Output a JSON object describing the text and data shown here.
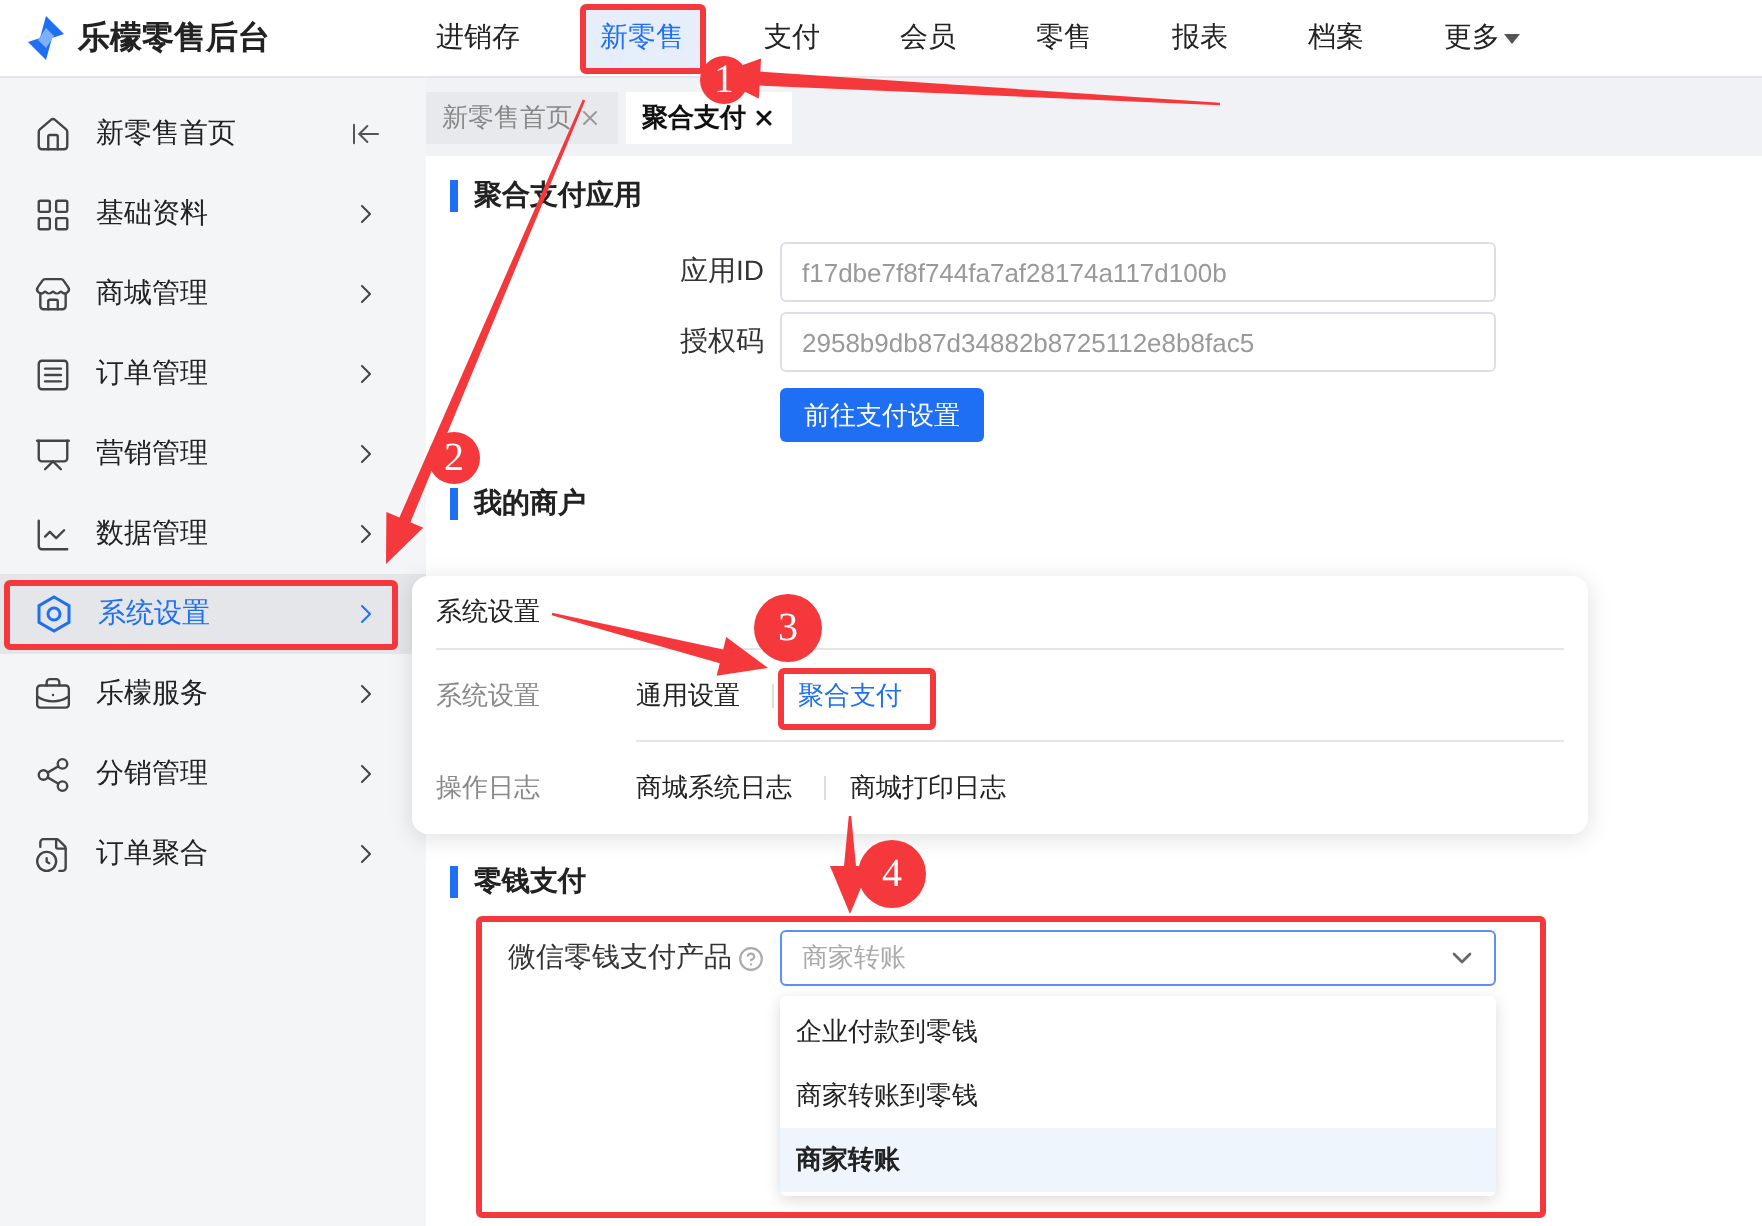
{
  "app": {
    "title": "乐檬零售后台"
  },
  "top_nav": [
    {
      "label": "进销存",
      "selected": false,
      "dropdown": false
    },
    {
      "label": "新零售",
      "selected": true,
      "dropdown": false
    },
    {
      "label": "支付",
      "selected": false,
      "dropdown": false
    },
    {
      "label": "会员",
      "selected": false,
      "dropdown": false
    },
    {
      "label": "零售",
      "selected": false,
      "dropdown": false
    },
    {
      "label": "报表",
      "selected": false,
      "dropdown": false
    },
    {
      "label": "档案",
      "selected": false,
      "dropdown": false
    },
    {
      "label": "更多",
      "selected": false,
      "dropdown": true
    }
  ],
  "sidebar": {
    "items": [
      {
        "label": "新零售首页",
        "selected": false,
        "kind": "page"
      },
      {
        "label": "基础资料",
        "selected": false,
        "kind": "group"
      },
      {
        "label": "商城管理",
        "selected": false,
        "kind": "group"
      },
      {
        "label": "订单管理",
        "selected": false,
        "kind": "group"
      },
      {
        "label": "营销管理",
        "selected": false,
        "kind": "group"
      },
      {
        "label": "数据管理",
        "selected": false,
        "kind": "group"
      },
      {
        "label": "系统设置",
        "selected": true,
        "kind": "group"
      },
      {
        "label": "乐檬服务",
        "selected": false,
        "kind": "group"
      },
      {
        "label": "分销管理",
        "selected": false,
        "kind": "group"
      },
      {
        "label": "订单聚合",
        "selected": false,
        "kind": "group"
      }
    ]
  },
  "tabs": [
    {
      "label": "新零售首页",
      "selected": false
    },
    {
      "label": "聚合支付",
      "selected": true
    }
  ],
  "payment_app": {
    "heading": "聚合支付应用",
    "fields": [
      {
        "label": "应用ID",
        "value": "f17dbe7f8f744fa7af28174a117d100b"
      },
      {
        "label": "授权码",
        "value": "2958b9db87d34882b8725112e8b8fac5"
      }
    ],
    "button": "前往支付设置"
  },
  "merchant": {
    "heading": "我的商户"
  },
  "settings_popover": {
    "title": "系统设置",
    "groups": [
      {
        "label": "系统设置",
        "links": [
          {
            "label": "通用设置",
            "selected": false
          },
          {
            "label": "聚合支付",
            "selected": true
          }
        ]
      },
      {
        "label": "操作日志",
        "links": [
          {
            "label": "商城系统日志",
            "selected": false
          },
          {
            "label": "商城打印日志",
            "selected": false
          }
        ]
      }
    ]
  },
  "change_payment": {
    "heading": "零钱支付",
    "field": {
      "label": "微信零钱支付产品",
      "placeholder": "商家转账",
      "expanded": true,
      "options": [
        {
          "label": "企业付款到零钱",
          "selected": false
        },
        {
          "label": "商家转账到零钱",
          "selected": false
        },
        {
          "label": "商家转账",
          "selected": true
        }
      ]
    }
  },
  "annotations": {
    "steps": [
      "1",
      "2",
      "3",
      "4"
    ]
  }
}
